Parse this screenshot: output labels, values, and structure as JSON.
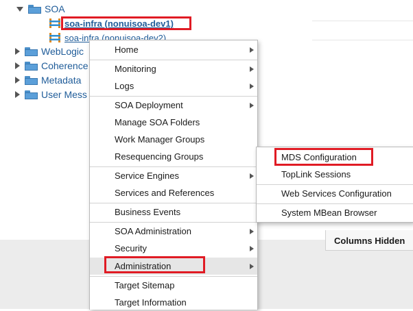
{
  "tree": {
    "soa": "SOA",
    "soa_infra_dev1": "soa-infra (nonuisoa-dev1)",
    "soa_infra_dev2": "soa-infra (nonuisoa-dev2)",
    "weblogic": "WebLogic",
    "coherence": "Coherence",
    "metadata": "Metadata",
    "user_messaging": "User Mess"
  },
  "right_pane": {
    "columns_hidden": "Columns Hidden"
  },
  "context_menu": {
    "items": [
      "Home",
      "Monitoring",
      "Logs",
      "SOA Deployment",
      "Manage SOA Folders",
      "Work Manager Groups",
      "Resequencing Groups",
      "Service Engines",
      "Services and References",
      "Business Events",
      "SOA Administration",
      "Security",
      "Administration",
      "Target Sitemap",
      "Target Information"
    ]
  },
  "submenu": {
    "items": [
      "MDS Configuration",
      "TopLink Sessions",
      "Web Services Configuration",
      "System MBean Browser"
    ]
  },
  "colors": {
    "highlight_border": "#e01b24",
    "link": "#1f5c99",
    "folder": "#5b9fd9"
  }
}
